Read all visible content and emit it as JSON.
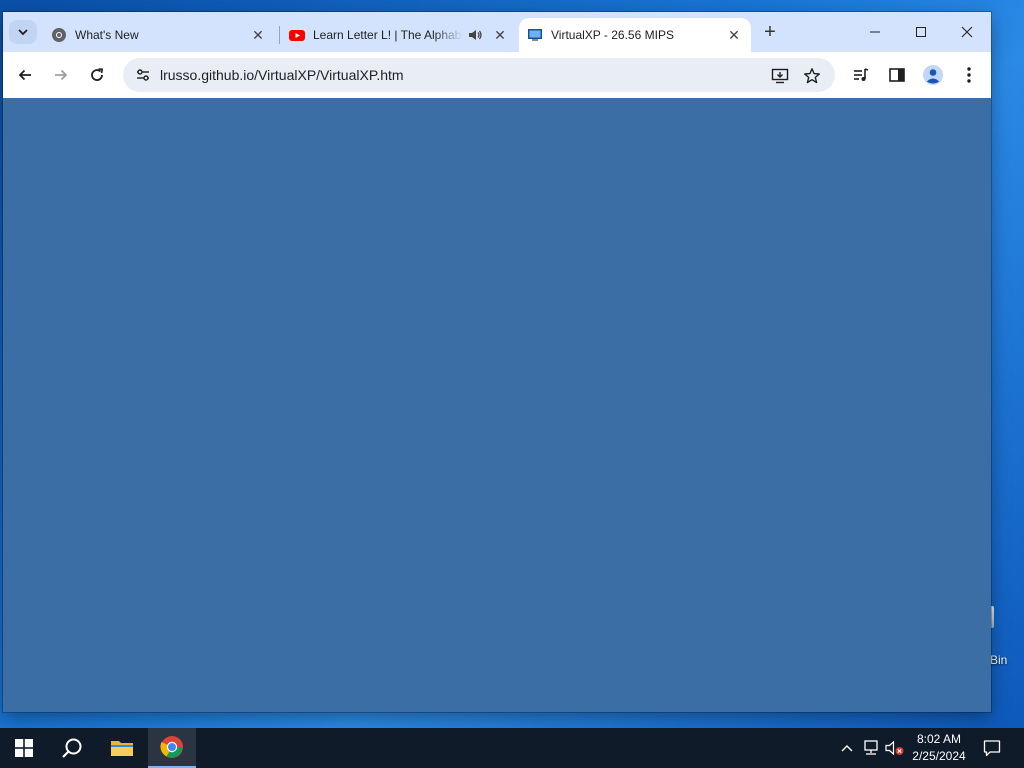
{
  "desktop": {
    "partial_icon_label": "Bin"
  },
  "browser": {
    "tabs": [
      {
        "title": "What's New",
        "favicon": "chrome-icon"
      },
      {
        "title": "Learn Letter L! | The Alphabet",
        "favicon": "youtube-icon",
        "audio": "speaker-icon"
      },
      {
        "title": "VirtualXP - 26.56 MIPS",
        "favicon": "virtualxp-icon",
        "active": true
      }
    ],
    "url": "lrusso.github.io/VirtualXP/VirtualXP.htm",
    "content_background": "#3b6ea5",
    "tabstrip_background": "#d3e3fd"
  },
  "taskbar": {
    "time": "8:02 AM",
    "date": "2/25/2024",
    "apps": [
      "start-icon",
      "search-icon",
      "file-explorer-icon",
      "chrome-icon"
    ]
  }
}
